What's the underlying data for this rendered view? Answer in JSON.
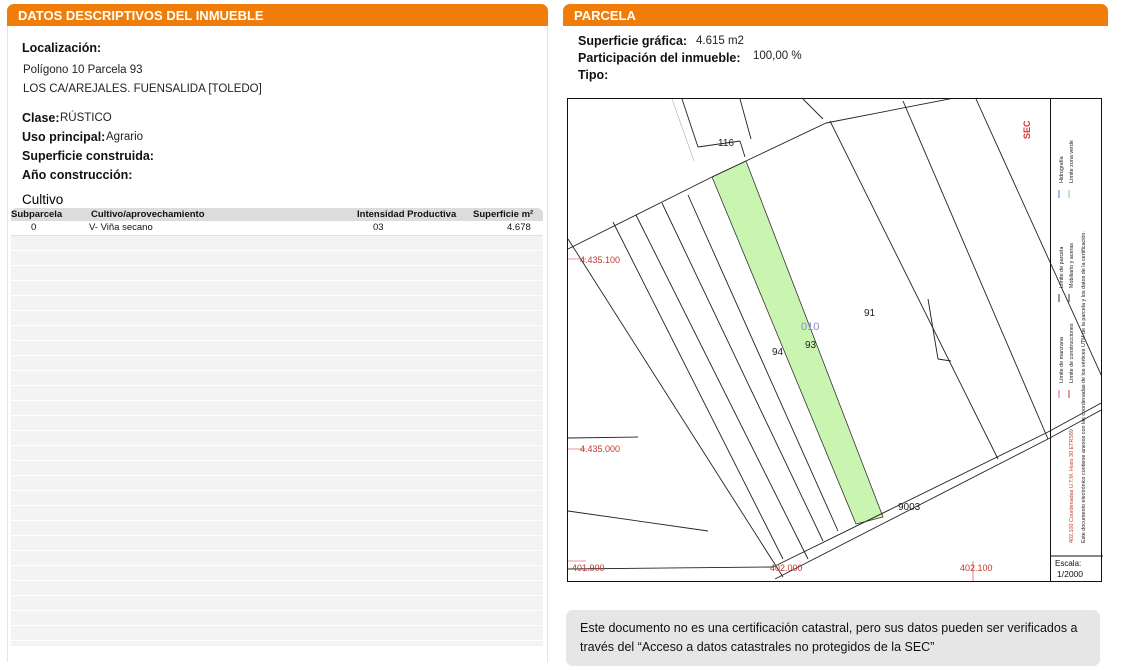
{
  "left_panel": {
    "title": "DATOS DESCRIPTIVOS DEL INMUEBLE",
    "localizacion_label": "Localización:",
    "address_line1": "Polígono 10 Parcela 93",
    "address_line2": "LOS CA/AREJALES. FUENSALIDA [TOLEDO]",
    "clase_label": "Clase:",
    "clase_value": "RÚSTICO",
    "uso_label": "Uso principal:",
    "uso_value": "Agrario",
    "superficie_construida_label": "Superficie construida:",
    "anio_label": "Año construcción:",
    "cultivo_title": "Cultivo",
    "table": {
      "headers": [
        "Subparcela",
        "Cultivo/aprovechamiento",
        "Intensidad Productiva",
        "Superficie m²"
      ],
      "rows": [
        [
          "0",
          "V- Viña secano",
          "03",
          "4.678"
        ]
      ]
    }
  },
  "right_panel": {
    "title": "PARCELA",
    "superficie_grafica_label": "Superficie gráfica:",
    "superficie_grafica_value": "4.615 m2",
    "participacion_label": "Participación del inmueble:",
    "participacion_value": "100,00 %",
    "tipo_label": "Tipo:",
    "map": {
      "labels": {
        "p116": "116",
        "p91": "91",
        "p94": "94",
        "p93": "93",
        "p010": "010",
        "p9003": "9003",
        "y_upper": "4.435.100",
        "y_lower": "4.435.000",
        "x_left": "401.900",
        "x_mid": "402.000",
        "x_right": "402.100"
      },
      "legend": {
        "line1": "Límite de manzana",
        "line2": "Límite de parcela",
        "line3": "Límite de construcciones",
        "line4": "Mobiliario y aceras",
        "line5": "Límite zona verde",
        "line6": "Hidrografía",
        "coords": "402,100 Coordenadas U.T.M. Huso 30 ETRS89",
        "note": "Este documento electrónico contiene anexos con las coordenadas de los vértices UTM de la parcela y los datos de la certificación."
      },
      "scale_label": "Escala:",
      "scale_value": "1/2000",
      "colors": {
        "parcel_fill": "#c9f5b0",
        "coord_text": "#c0392b",
        "parcel_id": "#7f8fc7"
      }
    },
    "note": "Este documento no es una certificación catastral, pero sus datos pueden ser verificados a través del “Acceso a datos catastrales no protegidos de la SEC”"
  },
  "colors": {
    "header_orange": "#f07d0a",
    "note_bg": "#e6e6e6"
  }
}
